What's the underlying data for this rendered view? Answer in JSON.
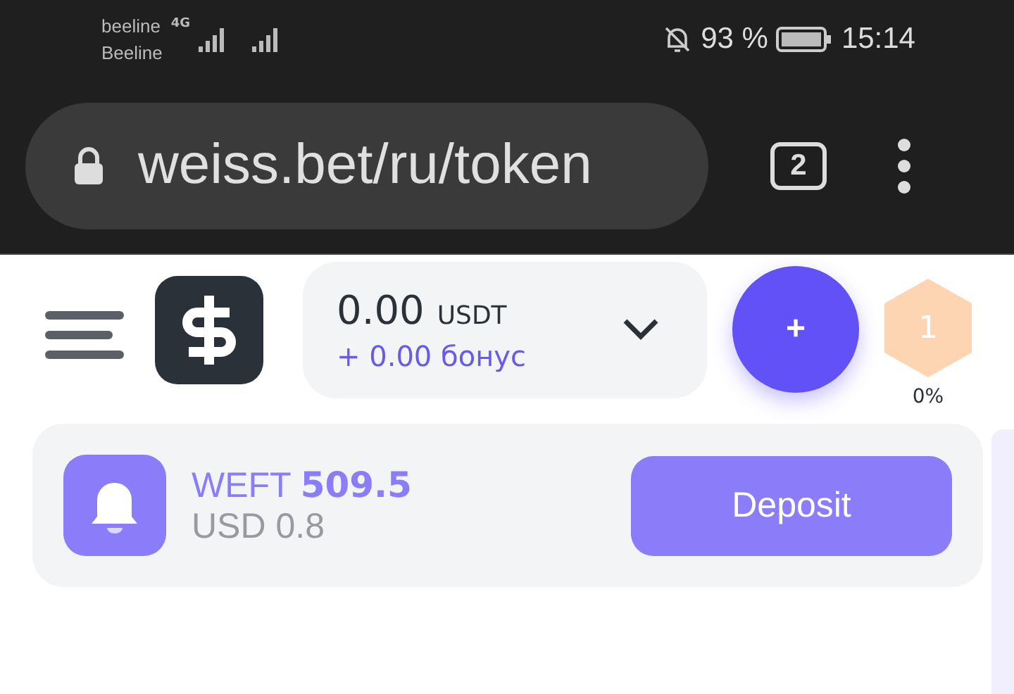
{
  "status_bar": {
    "carriers": [
      "beeline",
      "Beeline"
    ],
    "network": "4G",
    "battery": "93 %",
    "time": "15:14"
  },
  "browser": {
    "url": "weiss.bet/ru/token",
    "tab_count": "2"
  },
  "header": {
    "balance": "0.00",
    "currency": "USDT",
    "bonus": "+ 0.00 бонус",
    "add": "+",
    "level": "1",
    "progress": "0%"
  },
  "token_card": {
    "title": "WEFT **509.5**",
    "subtitle": "USD 0.8",
    "button": "Deposit"
  }
}
